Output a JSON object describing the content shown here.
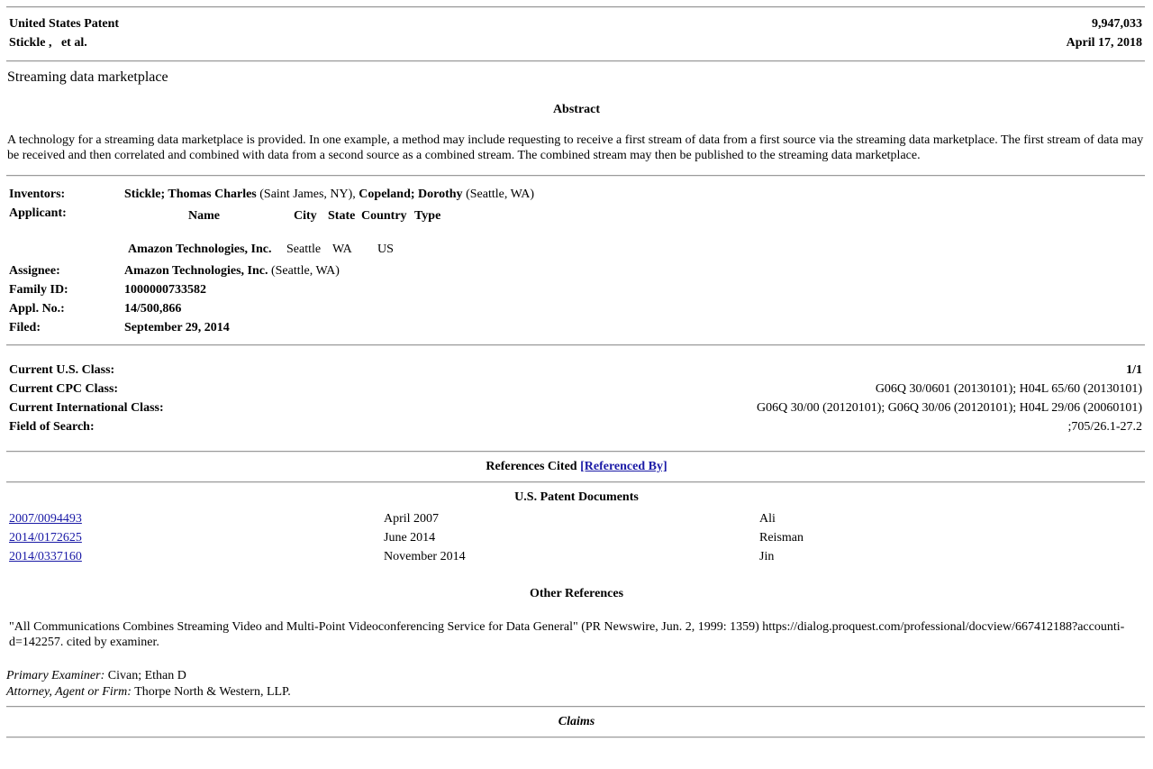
{
  "header": {
    "patent_label": "United States Patent",
    "patent_number": "9,947,033",
    "inventors_short": "Stickle ,   et al.",
    "date": "April 17, 2018"
  },
  "title": "Streaming data marketplace",
  "abstract": {
    "heading": "Abstract",
    "text": "A technology for a streaming data marketplace is provided. In one example, a method may include requesting to receive a first stream of data from a first source via the streaming data marketplace. The first stream of data may be received and then correlated and combined with data from a second source as a combined stream. The combined stream may then be published to the streaming data marketplace."
  },
  "details": {
    "inventors_label": "Inventors:",
    "inventor1_name": "Stickle; Thomas Charles",
    "inventor1_loc": "(Saint James, NY),",
    "inventor2_name": "Copeland; Dorothy",
    "inventor2_loc": "(Seattle, WA)",
    "applicant_label": "Applicant:",
    "applicant_headers": {
      "name": "Name",
      "city": "City",
      "state": "State",
      "country": "Country",
      "type": "Type"
    },
    "applicant_row": {
      "name": "Amazon Technologies, Inc.",
      "city": "Seattle",
      "state": "WA",
      "country": "US"
    },
    "assignee_label": "Assignee:",
    "assignee_name": "Amazon Technologies, Inc.",
    "assignee_loc": "(Seattle, WA)",
    "family_id_label": "Family ID:",
    "family_id": "1000000733582",
    "appl_no_label": "Appl. No.:",
    "appl_no": "14/500,866",
    "filed_label": "Filed:",
    "filed": "September 29, 2014"
  },
  "classes": {
    "us_class_label": "Current U.S. Class:",
    "us_class": "1/1",
    "cpc_label": "Current CPC Class:",
    "cpc": "G06Q 30/0601 (20130101); H04L 65/60 (20130101)",
    "intl_label": "Current International Class:",
    "intl": "G06Q 30/00 (20120101); G06Q 30/06 (20120101); H04L 29/06 (20060101)",
    "search_label": "Field of Search:",
    "search": ";705/26.1-27.2"
  },
  "references": {
    "heading": "References Cited",
    "referenced_by": "[Referenced By]",
    "us_docs_heading": "U.S. Patent Documents",
    "us_docs": [
      {
        "number": "2007/0094493",
        "date": "April 2007",
        "name": "Ali"
      },
      {
        "number": "2014/0172625",
        "date": "June 2014",
        "name": "Reisman"
      },
      {
        "number": "2014/0337160",
        "date": "November 2014",
        "name": "Jin"
      }
    ],
    "other_heading": "Other References",
    "other_text": "\"All Communications Combines Streaming Video and Multi-Point Videoconferencing Service for Data General\" (PR Newswire, Jun. 2, 1999: 1359) https://dialog.proquest.com/professional/docview/667412188?accounti- d=142257. cited by examiner."
  },
  "examiner": {
    "primary_label": "Primary Examiner:",
    "primary": "Civan; Ethan D",
    "attorney_label": "Attorney, Agent or Firm:",
    "attorney": "Thorpe North & Western, LLP."
  },
  "claims_heading": "Claims"
}
